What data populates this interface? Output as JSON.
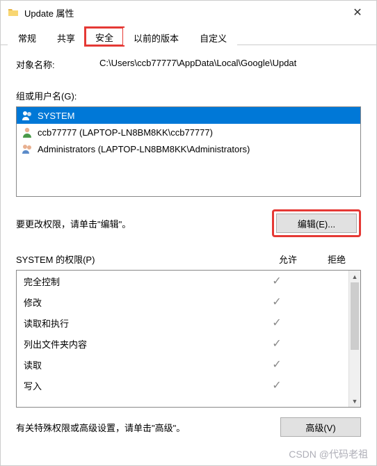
{
  "window": {
    "title": "Update 属性",
    "close": "✕"
  },
  "tabs": {
    "items": [
      {
        "label": "常规"
      },
      {
        "label": "共享"
      },
      {
        "label": "安全"
      },
      {
        "label": "以前的版本"
      },
      {
        "label": "自定义"
      }
    ]
  },
  "path": {
    "label": "对象名称:",
    "value": "C:\\Users\\ccb77777\\AppData\\Local\\Google\\Updat"
  },
  "groups": {
    "label": "组或用户名(G):",
    "items": [
      {
        "name": "SYSTEM",
        "icon": "users"
      },
      {
        "name": "ccb77777 (LAPTOP-LN8BM8KK\\ccb77777)",
        "icon": "user"
      },
      {
        "name": "Administrators (LAPTOP-LN8BM8KK\\Administrators)",
        "icon": "users"
      }
    ]
  },
  "edit": {
    "hint": "要更改权限，请单击\"编辑\"。",
    "button": "编辑(E)..."
  },
  "perms": {
    "header_name": "SYSTEM 的权限(P)",
    "col_allow": "允许",
    "col_deny": "拒绝",
    "rows": [
      {
        "name": "完全控制",
        "allow": true,
        "deny": false
      },
      {
        "name": "修改",
        "allow": true,
        "deny": false
      },
      {
        "name": "读取和执行",
        "allow": true,
        "deny": false
      },
      {
        "name": "列出文件夹内容",
        "allow": true,
        "deny": false
      },
      {
        "name": "读取",
        "allow": true,
        "deny": false
      },
      {
        "name": "写入",
        "allow": true,
        "deny": false
      }
    ]
  },
  "advanced": {
    "hint": "有关特殊权限或高级设置，请单击\"高级\"。",
    "button": "高级(V)"
  },
  "watermark": "CSDN @代码老祖",
  "checkmark": "✓"
}
